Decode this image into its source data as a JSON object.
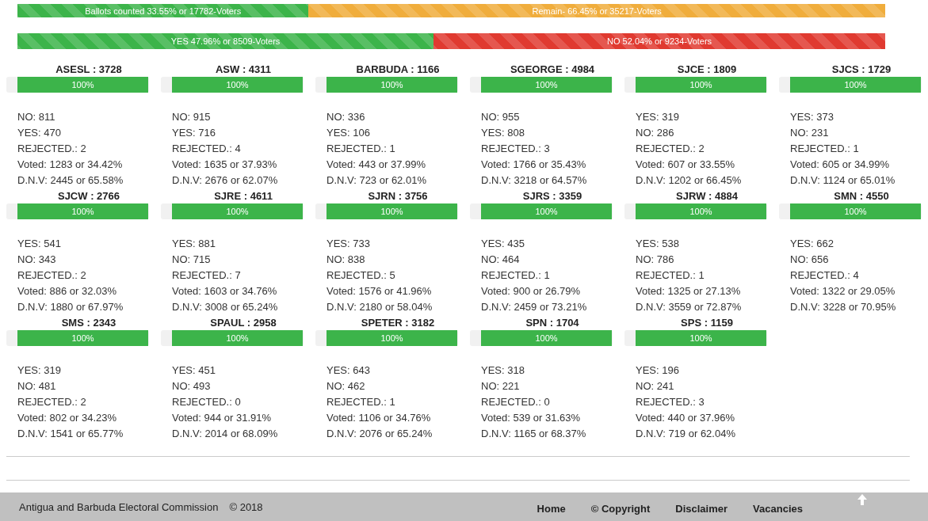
{
  "summary_bars": [
    {
      "segments": [
        {
          "label": "Ballots counted 33.55% or 17782-Voters",
          "level": 0.3355,
          "color": "#3cb44a"
        },
        {
          "label": "Remain- 66.45% or 35217-Voters",
          "level": 0.6645,
          "color": "#f0ad3c"
        }
      ]
    },
    {
      "segments": [
        {
          "label": "YES 47.96% or 8509-Voters",
          "level": 0.4796,
          "color": "#3cb44a"
        },
        {
          "label": "NO 52.04% or 9234-Voters",
          "level": 0.5204,
          "color": "#e03a30"
        }
      ]
    }
  ],
  "constituencies": [
    {
      "name": "ASESL : 3728",
      "level": 1,
      "progress": "100%",
      "lines": [
        "NO: 811",
        "YES: 470",
        "REJECTED.: 2",
        "Voted: 1283 or 34.42%",
        "D.N.V: 2445 or 65.58%"
      ]
    },
    {
      "name": "ASW : 4311",
      "level": 1,
      "progress": "100%",
      "lines": [
        "NO: 915",
        "YES: 716",
        "REJECTED.: 4",
        "Voted: 1635 or 37.93%",
        "D.N.V: 2676 or 62.07%"
      ]
    },
    {
      "name": "BARBUDA : 1166",
      "level": 1,
      "progress": "100%",
      "lines": [
        "NO: 336",
        "YES: 106",
        "REJECTED.: 1",
        "Voted: 443 or 37.99%",
        "D.N.V: 723 or 62.01%"
      ]
    },
    {
      "name": "SGEORGE : 4984",
      "level": 1,
      "progress": "100%",
      "lines": [
        "NO: 955",
        "YES: 808",
        "REJECTED.: 3",
        "Voted: 1766 or 35.43%",
        "D.N.V: 3218 or 64.57%"
      ]
    },
    {
      "name": "SJCE : 1809",
      "level": 1,
      "progress": "100%",
      "lines": [
        "YES: 319",
        "NO: 286",
        "REJECTED.: 2",
        "Voted: 607 or 33.55%",
        "D.N.V: 1202 or 66.45%"
      ]
    },
    {
      "name": "SJCS : 1729",
      "level": 1,
      "progress": "100%",
      "lines": [
        "YES: 373",
        "NO: 231",
        "REJECTED.: 1",
        "Voted: 605 or 34.99%",
        "D.N.V: 1124 or 65.01%"
      ]
    },
    {
      "name": "SJCW : 2766",
      "level": 1,
      "progress": "100%",
      "lines": [
        "YES: 541",
        "NO: 343",
        "REJECTED.: 2",
        "Voted: 886 or 32.03%",
        "D.N.V: 1880 or 67.97%"
      ]
    },
    {
      "name": "SJRE : 4611",
      "level": 1,
      "progress": "100%",
      "lines": [
        "YES: 881",
        "NO: 715",
        "REJECTED.: 7",
        "Voted: 1603 or 34.76%",
        "D.N.V: 3008 or 65.24%"
      ]
    },
    {
      "name": "SJRN : 3756",
      "level": 1,
      "progress": "100%",
      "lines": [
        "YES: 733",
        "NO: 838",
        "REJECTED.: 5",
        "Voted: 1576 or 41.96%",
        "D.N.V: 2180 or 58.04%"
      ]
    },
    {
      "name": "SJRS : 3359",
      "level": 1,
      "progress": "100%",
      "lines": [
        "YES: 435",
        "NO: 464",
        "REJECTED.: 1",
        "Voted: 900 or 26.79%",
        "D.N.V: 2459 or 73.21%"
      ]
    },
    {
      "name": "SJRW : 4884",
      "level": 1,
      "progress": "100%",
      "lines": [
        "YES: 538",
        "NO: 786",
        "REJECTED.: 1",
        "Voted: 1325 or 27.13%",
        "D.N.V: 3559 or 72.87%"
      ]
    },
    {
      "name": "SMN : 4550",
      "level": 1,
      "progress": "100%",
      "lines": [
        "YES: 662",
        "NO: 656",
        "REJECTED.: 4",
        "Voted: 1322 or 29.05%",
        "D.N.V: 3228 or 70.95%"
      ]
    },
    {
      "name": "SMS : 2343",
      "level": 1,
      "progress": "100%",
      "lines": [
        "YES: 319",
        "NO: 481",
        "REJECTED.: 2",
        "Voted: 802 or 34.23%",
        "D.N.V: 1541 or 65.77%"
      ]
    },
    {
      "name": "SPAUL : 2958",
      "level": 1,
      "progress": "100%",
      "lines": [
        "YES: 451",
        "NO: 493",
        "REJECTED.: 0",
        "Voted: 944 or 31.91%",
        "D.N.V: 2014 or 68.09%"
      ]
    },
    {
      "name": "SPETER : 3182",
      "level": 1,
      "progress": "100%",
      "lines": [
        "YES: 643",
        "NO: 462",
        "REJECTED.: 1",
        "Voted: 1106 or 34.76%",
        "D.N.V: 2076 or 65.24%"
      ]
    },
    {
      "name": "SPN : 1704",
      "level": 1,
      "progress": "100%",
      "lines": [
        "YES: 318",
        "NO: 221",
        "REJECTED.: 0",
        "Voted: 539 or 31.63%",
        "D.N.V: 1165 or 68.37%"
      ]
    },
    {
      "name": "SPS : 1159",
      "level": 1,
      "progress": "100%",
      "lines": [
        "YES: 196",
        "NO: 241",
        "REJECTED.: 3",
        "Voted: 440 or 37.96%",
        "D.N.V: 719 or 62.04%"
      ]
    }
  ],
  "footer": {
    "organization": "Antigua and Barbuda Electoral Commission",
    "copyright": "© 2018",
    "links": [
      "Home",
      "© Copyright",
      "Disclaimer",
      "Vacancies"
    ]
  }
}
